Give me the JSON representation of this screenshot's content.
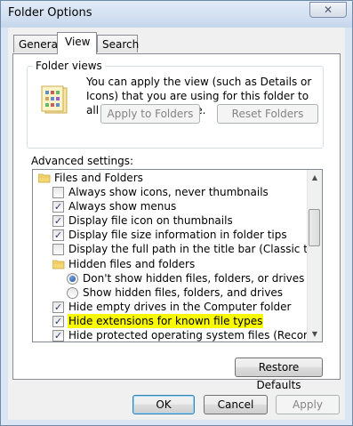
{
  "window": {
    "title": "Folder Options",
    "close_glyph": "✕"
  },
  "tabs": [
    {
      "label": "General",
      "active": false
    },
    {
      "label": "View",
      "active": true
    },
    {
      "label": "Search",
      "active": false
    }
  ],
  "folder_views": {
    "caption": "Folder views",
    "icon": "folder-views-icon",
    "description": "You can apply the view (such as Details or Icons) that you are using for this folder to all folders of this type.",
    "apply_label": "Apply to Folders",
    "reset_label": "Reset Folders"
  },
  "advanced": {
    "label": "Advanced settings:",
    "items": [
      {
        "type": "folder",
        "label": "Files and Folders",
        "level": 0
      },
      {
        "type": "checkbox",
        "label": "Always show icons, never thumbnails",
        "checked": false,
        "level": 1
      },
      {
        "type": "checkbox",
        "label": "Always show menus",
        "checked": true,
        "level": 1
      },
      {
        "type": "checkbox",
        "label": "Display file icon on thumbnails",
        "checked": true,
        "level": 1
      },
      {
        "type": "checkbox",
        "label": "Display file size information in folder tips",
        "checked": true,
        "level": 1
      },
      {
        "type": "checkbox",
        "label": "Display the full path in the title bar (Classic theme only)",
        "checked": false,
        "level": 1
      },
      {
        "type": "folder",
        "label": "Hidden files and folders",
        "level": 1
      },
      {
        "type": "radio",
        "label": "Don't show hidden files, folders, or drives",
        "selected": true,
        "level": 2
      },
      {
        "type": "radio",
        "label": "Show hidden files, folders, and drives",
        "selected": false,
        "level": 2
      },
      {
        "type": "checkbox",
        "label": "Hide empty drives in the Computer folder",
        "checked": true,
        "level": 1
      },
      {
        "type": "checkbox",
        "label": "Hide extensions for known file types",
        "checked": true,
        "level": 1,
        "highlighted": true
      },
      {
        "type": "checkbox",
        "label": "Hide protected operating system files (Recommended)",
        "checked": true,
        "level": 1
      }
    ],
    "check_glyph": "✓",
    "scroll_up_glyph": "▲",
    "scroll_down_glyph": "▼",
    "highlight_color": "#f9f900"
  },
  "restore_defaults_label": "Restore Defaults",
  "buttons": {
    "ok": "OK",
    "cancel": "Cancel",
    "apply": "Apply"
  },
  "colors": {
    "frame": "#dbe6f4",
    "client": "#f0f0f0",
    "check": "#2c3d66"
  }
}
